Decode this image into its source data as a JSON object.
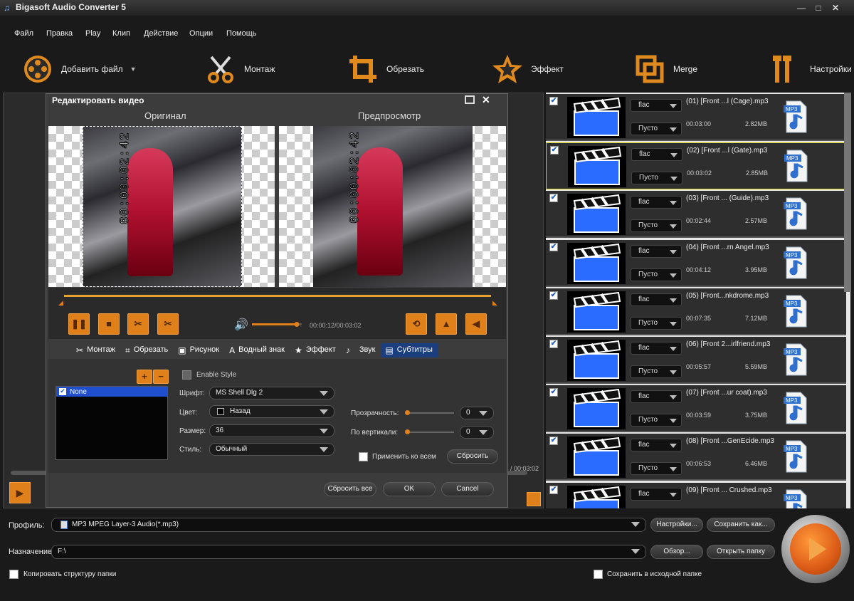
{
  "window": {
    "title": "Bigasoft Audio Converter 5"
  },
  "menu": [
    "Файл",
    "Правка",
    "Play",
    "Клип",
    "Действие",
    "Опции",
    "Помощь"
  ],
  "toolbar": {
    "add_file": "Добавить файл",
    "montage": "Монтаж",
    "crop": "Обрезать",
    "effect": "Эффект",
    "merge": "Merge",
    "settings": "Настройки"
  },
  "files": [
    {
      "format": "flac",
      "subtitle": "Пусто",
      "name": "(01) [Front ...l (Cage).mp3",
      "duration": "00:03:00",
      "size": "2.82MB",
      "badge": "MP3",
      "checked": true
    },
    {
      "format": "flac",
      "subtitle": "Пусто",
      "name": "(02) [Front ...l (Gate).mp3",
      "duration": "00:03:02",
      "size": "2.85MB",
      "badge": "MP3",
      "checked": true
    },
    {
      "format": "flac",
      "subtitle": "Пусто",
      "name": "(03) [Front ... (Guide).mp3",
      "duration": "00:02:44",
      "size": "2.57MB",
      "badge": "MP3",
      "checked": true
    },
    {
      "format": "flac",
      "subtitle": "Пусто",
      "name": "(04) [Front ...rn Angel.mp3",
      "duration": "00:04:12",
      "size": "3.95MB",
      "badge": "MP3",
      "checked": true
    },
    {
      "format": "flac",
      "subtitle": "Пусто",
      "name": "(05) [Front...nkdrome.mp3",
      "duration": "00:07:35",
      "size": "7.12MB",
      "badge": "MP3",
      "checked": true
    },
    {
      "format": "flac",
      "subtitle": "Пусто",
      "name": "(06) [Front 2...irlfriend.mp3",
      "duration": "00:05:57",
      "size": "5.59MB",
      "badge": "MP3",
      "checked": true
    },
    {
      "format": "flac",
      "subtitle": "Пусто",
      "name": "(07) [Front ...ur coat).mp3",
      "duration": "00:03:59",
      "size": "3.75MB",
      "badge": "MP3",
      "checked": true
    },
    {
      "format": "flac",
      "subtitle": "Пусто",
      "name": "(08) [Front ...GenEcide.mp3",
      "duration": "00:06:53",
      "size": "6.46MB",
      "badge": "MP3",
      "checked": true
    },
    {
      "format": "flac",
      "subtitle": "",
      "name": "(09) [Front ... Crushed.mp3",
      "duration": "",
      "size": "",
      "badge": "MP3",
      "checked": true
    }
  ],
  "dialog": {
    "title": "Редактировать видео",
    "original": "Оригинал",
    "preview": "Предпросмотр",
    "timestamp": "00:00:02:42",
    "time_display": "00:00:12/00:03:02",
    "volume": 0.9,
    "tabs": {
      "montage": "Монтаж",
      "crop": "Обрезать",
      "picture": "Рисунок",
      "watermark": "Водный знак",
      "effect": "Эффект",
      "sound": "Звук",
      "subtitles": "Субтитры"
    },
    "subtitle_list": [
      "None"
    ],
    "enable_style": "Enable Style",
    "font_label": "Шрифт:",
    "font_value": "MS Shell Dlg 2",
    "color_label": "Цвет:",
    "color_value": "Назад",
    "size_label": "Размер:",
    "size_value": "36",
    "style_label": "Стиль:",
    "style_value": "Обычный",
    "transparency_label": "Прозрачность:",
    "transparency_value": "0",
    "vertical_label": "По вертикали:",
    "vertical_value": "0",
    "apply_all": "Применить ко всем",
    "reset": "Сбросить",
    "reset_all": "Сбросить все",
    "ok": "OK",
    "cancel": "Cancel"
  },
  "behind": {
    "time_fragment": "/ 00:03:02"
  },
  "bottom": {
    "profile_label": "Профиль:",
    "profile_value": "MP3 MPEG Layer-3 Audio(*.mp3)",
    "settings_btn": "Настройки...",
    "save_as_btn": "Сохранить как...",
    "dest_label": "Назначение:",
    "dest_value": "F:\\",
    "browse_btn": "Обзор...",
    "open_folder_btn": "Открыть папку",
    "copy_structure": "Копировать структуру папки",
    "save_source": "Сохранить в исходной папке"
  },
  "colors": {
    "accent_orange": "#e0801a",
    "selected_tab": "#1b3e7e",
    "list_highlight": "#1f4fcf"
  }
}
